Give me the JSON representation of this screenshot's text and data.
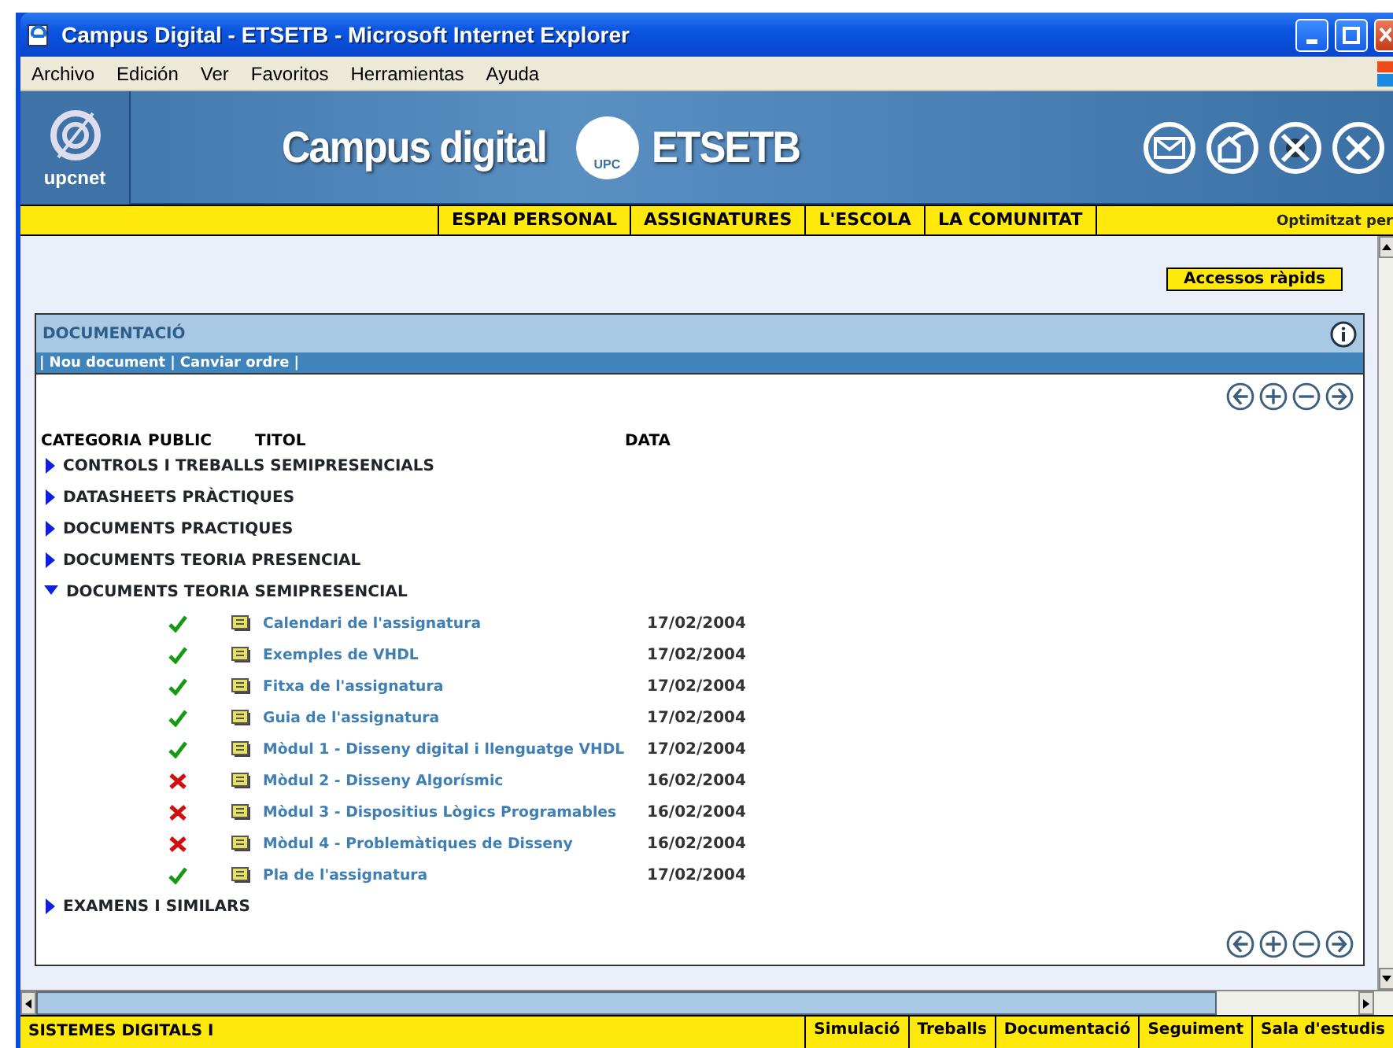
{
  "window": {
    "title": "Campus Digital - ETSETB - Microsoft Internet Explorer"
  },
  "menu": [
    "Archivo",
    "Edición",
    "Ver",
    "Favoritos",
    "Herramientas",
    "Ayuda"
  ],
  "header": {
    "logo_text": "upcnet",
    "title": "Campus digital",
    "seal_text": "UPC",
    "school": "ETSETB"
  },
  "nav": {
    "items": [
      "ESPAI PERSONAL",
      "ASSIGNATURES",
      "L'ESCOLA",
      "LA COMUNITAT"
    ],
    "note": "Optimitzat per"
  },
  "quick_access": "Accessos ràpids",
  "panel": {
    "title": "DOCUMENTACIÓ",
    "separator": "|",
    "actions": [
      "Nou document",
      "Canviar ordre"
    ],
    "columns": [
      "CATEGORIA",
      "PUBLIC",
      "TITOL",
      "DATA"
    ],
    "categories": [
      {
        "name": "CONTROLS I TREBALLS SEMIPRESENCIALS",
        "expanded": false
      },
      {
        "name": "DATASHEETS PRÀCTIQUES",
        "expanded": false
      },
      {
        "name": "DOCUMENTS PRACTIQUES",
        "expanded": false
      },
      {
        "name": "DOCUMENTS TEORIA PRESENCIAL",
        "expanded": false
      },
      {
        "name": "DOCUMENTS TEORIA SEMIPRESENCIAL",
        "expanded": true,
        "children": [
          {
            "public": true,
            "title": "Calendari de l'assignatura",
            "date": "17/02/2004"
          },
          {
            "public": true,
            "title": "Exemples de VHDL",
            "date": "17/02/2004"
          },
          {
            "public": true,
            "title": "Fitxa de l'assignatura",
            "date": "17/02/2004"
          },
          {
            "public": true,
            "title": "Guia de l'assignatura",
            "date": "17/02/2004"
          },
          {
            "public": true,
            "title": "Mòdul 1 - Disseny digital i llenguatge VHDL",
            "date": "17/02/2004"
          },
          {
            "public": false,
            "title": "Mòdul 2 - Disseny Algorísmic",
            "date": "16/02/2004"
          },
          {
            "public": false,
            "title": "Mòdul 3 - Dispositius Lògics Programables",
            "date": "16/02/2004"
          },
          {
            "public": false,
            "title": "Mòdul 4 - Problemàtiques de Disseny",
            "date": "16/02/2004"
          },
          {
            "public": true,
            "title": "Pla de l'assignatura",
            "date": "17/02/2004"
          }
        ]
      },
      {
        "name": "EXAMENS I SIMILARS",
        "expanded": false
      }
    ]
  },
  "footer": {
    "course": "SISTEMES DIGITALS I",
    "tabs": [
      "Simulació",
      "Treballs",
      "Documentació",
      "Seguiment",
      "Sala d'estudis"
    ]
  }
}
